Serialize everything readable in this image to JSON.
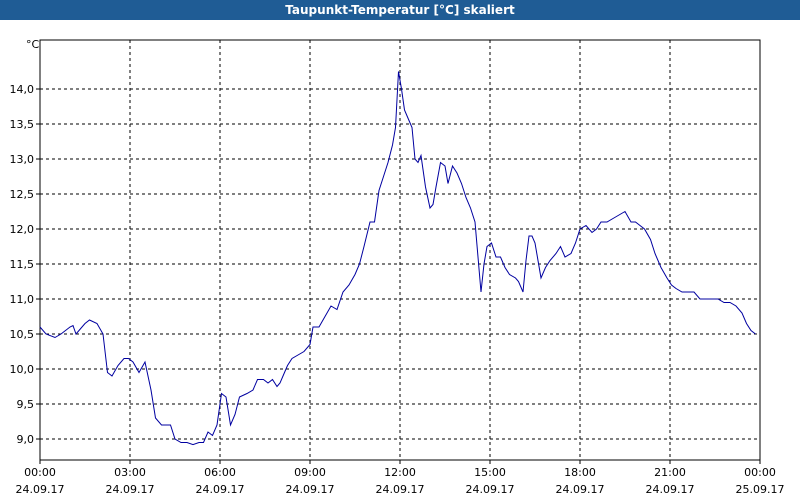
{
  "window": {
    "title": "Taupunkt-Temperatur [°C] skaliert"
  },
  "chart_data": {
    "type": "line",
    "title": "Taupunkt-Temperatur [°C] skaliert",
    "ylabel": "°C",
    "xlabel": "",
    "ylim": [
      8.7,
      14.7
    ],
    "xlim_hours": [
      0,
      24
    ],
    "grid": true,
    "y_ticks": [
      {
        "value": 9.0,
        "label": "9,0"
      },
      {
        "value": 9.5,
        "label": "9,5"
      },
      {
        "value": 10.0,
        "label": "10,0"
      },
      {
        "value": 10.5,
        "label": "10,5"
      },
      {
        "value": 11.0,
        "label": "11,0"
      },
      {
        "value": 11.5,
        "label": "11,5"
      },
      {
        "value": 12.0,
        "label": "12,0"
      },
      {
        "value": 12.5,
        "label": "12,5"
      },
      {
        "value": 13.0,
        "label": "13,0"
      },
      {
        "value": 13.5,
        "label": "13,5"
      },
      {
        "value": 14.0,
        "label": "14,0"
      }
    ],
    "x_ticks": [
      {
        "hour": 0,
        "time": "00:00",
        "date": "24.09.17"
      },
      {
        "hour": 3,
        "time": "03:00",
        "date": "24.09.17"
      },
      {
        "hour": 6,
        "time": "06:00",
        "date": "24.09.17"
      },
      {
        "hour": 9,
        "time": "09:00",
        "date": "24.09.17"
      },
      {
        "hour": 12,
        "time": "12:00",
        "date": "24.09.17"
      },
      {
        "hour": 15,
        "time": "15:00",
        "date": "24.09.17"
      },
      {
        "hour": 18,
        "time": "18:00",
        "date": "24.09.17"
      },
      {
        "hour": 21,
        "time": "21:00",
        "date": "24.09.17"
      },
      {
        "hour": 24,
        "time": "00:00",
        "date": "25.09.17"
      }
    ],
    "series": [
      {
        "color": "#0000a0",
        "points": [
          [
            0.0,
            10.6
          ],
          [
            0.2,
            10.5
          ],
          [
            0.5,
            10.45
          ],
          [
            0.7,
            10.5
          ],
          [
            1.0,
            10.6
          ],
          [
            1.1,
            10.62
          ],
          [
            1.2,
            10.5
          ],
          [
            1.3,
            10.55
          ],
          [
            1.5,
            10.65
          ],
          [
            1.65,
            10.7
          ],
          [
            1.9,
            10.65
          ],
          [
            2.1,
            10.5
          ],
          [
            2.25,
            9.95
          ],
          [
            2.4,
            9.9
          ],
          [
            2.6,
            10.05
          ],
          [
            2.8,
            10.15
          ],
          [
            2.95,
            10.15
          ],
          [
            3.1,
            10.1
          ],
          [
            3.3,
            9.95
          ],
          [
            3.5,
            10.1
          ],
          [
            3.7,
            9.7
          ],
          [
            3.85,
            9.3
          ],
          [
            4.05,
            9.2
          ],
          [
            4.2,
            9.2
          ],
          [
            4.35,
            9.2
          ],
          [
            4.5,
            9.0
          ],
          [
            4.7,
            8.95
          ],
          [
            4.9,
            8.95
          ],
          [
            5.1,
            8.92
          ],
          [
            5.3,
            8.95
          ],
          [
            5.45,
            8.95
          ],
          [
            5.6,
            9.1
          ],
          [
            5.75,
            9.05
          ],
          [
            5.9,
            9.2
          ],
          [
            6.05,
            9.65
          ],
          [
            6.2,
            9.6
          ],
          [
            6.35,
            9.2
          ],
          [
            6.5,
            9.35
          ],
          [
            6.65,
            9.6
          ],
          [
            6.9,
            9.65
          ],
          [
            7.1,
            9.7
          ],
          [
            7.25,
            9.85
          ],
          [
            7.45,
            9.85
          ],
          [
            7.6,
            9.8
          ],
          [
            7.75,
            9.85
          ],
          [
            7.9,
            9.75
          ],
          [
            8.0,
            9.8
          ],
          [
            8.1,
            9.9
          ],
          [
            8.25,
            10.05
          ],
          [
            8.4,
            10.15
          ],
          [
            8.6,
            10.2
          ],
          [
            8.8,
            10.25
          ],
          [
            9.0,
            10.35
          ],
          [
            9.1,
            10.6
          ],
          [
            9.3,
            10.6
          ],
          [
            9.5,
            10.75
          ],
          [
            9.7,
            10.9
          ],
          [
            9.9,
            10.85
          ],
          [
            10.1,
            11.1
          ],
          [
            10.3,
            11.2
          ],
          [
            10.5,
            11.35
          ],
          [
            10.65,
            11.5
          ],
          [
            10.8,
            11.75
          ],
          [
            11.0,
            12.1
          ],
          [
            11.15,
            12.1
          ],
          [
            11.3,
            12.55
          ],
          [
            11.45,
            12.75
          ],
          [
            11.6,
            12.95
          ],
          [
            11.75,
            13.2
          ],
          [
            11.85,
            13.45
          ],
          [
            11.95,
            14.25
          ],
          [
            12.05,
            14.0
          ],
          [
            12.15,
            13.7
          ],
          [
            12.25,
            13.6
          ],
          [
            12.4,
            13.45
          ],
          [
            12.5,
            13.0
          ],
          [
            12.6,
            12.95
          ],
          [
            12.7,
            13.05
          ],
          [
            12.85,
            12.6
          ],
          [
            13.0,
            12.3
          ],
          [
            13.1,
            12.35
          ],
          [
            13.2,
            12.6
          ],
          [
            13.35,
            12.95
          ],
          [
            13.5,
            12.9
          ],
          [
            13.6,
            12.65
          ],
          [
            13.75,
            12.9
          ],
          [
            13.9,
            12.8
          ],
          [
            14.05,
            12.65
          ],
          [
            14.2,
            12.45
          ],
          [
            14.35,
            12.3
          ],
          [
            14.5,
            12.1
          ],
          [
            14.7,
            11.1
          ],
          [
            14.8,
            11.5
          ],
          [
            14.9,
            11.75
          ],
          [
            15.05,
            11.8
          ],
          [
            15.2,
            11.6
          ],
          [
            15.35,
            11.6
          ],
          [
            15.5,
            11.45
          ],
          [
            15.65,
            11.35
          ],
          [
            15.85,
            11.3
          ],
          [
            15.95,
            11.25
          ],
          [
            16.1,
            11.1
          ],
          [
            16.2,
            11.55
          ],
          [
            16.3,
            11.9
          ],
          [
            16.4,
            11.9
          ],
          [
            16.5,
            11.8
          ],
          [
            16.6,
            11.55
          ],
          [
            16.7,
            11.3
          ],
          [
            16.85,
            11.45
          ],
          [
            17.0,
            11.55
          ],
          [
            17.2,
            11.65
          ],
          [
            17.35,
            11.75
          ],
          [
            17.5,
            11.6
          ],
          [
            17.7,
            11.65
          ],
          [
            17.85,
            11.8
          ],
          [
            18.0,
            12.0
          ],
          [
            18.2,
            12.05
          ],
          [
            18.4,
            11.95
          ],
          [
            18.55,
            12.0
          ],
          [
            18.7,
            12.1
          ],
          [
            18.9,
            12.1
          ],
          [
            19.1,
            12.15
          ],
          [
            19.3,
            12.2
          ],
          [
            19.5,
            12.25
          ],
          [
            19.7,
            12.1
          ],
          [
            19.85,
            12.1
          ],
          [
            20.0,
            12.05
          ],
          [
            20.15,
            12.0
          ],
          [
            20.35,
            11.85
          ],
          [
            20.5,
            11.65
          ],
          [
            20.7,
            11.45
          ],
          [
            20.9,
            11.3
          ],
          [
            21.05,
            11.2
          ],
          [
            21.2,
            11.15
          ],
          [
            21.4,
            11.1
          ],
          [
            21.6,
            11.1
          ],
          [
            21.8,
            11.1
          ],
          [
            22.0,
            11.0
          ],
          [
            22.3,
            11.0
          ],
          [
            22.6,
            11.0
          ],
          [
            22.8,
            10.95
          ],
          [
            23.0,
            10.95
          ],
          [
            23.2,
            10.9
          ],
          [
            23.4,
            10.8
          ],
          [
            23.55,
            10.65
          ],
          [
            23.7,
            10.55
          ],
          [
            23.85,
            10.5
          ]
        ]
      }
    ]
  }
}
